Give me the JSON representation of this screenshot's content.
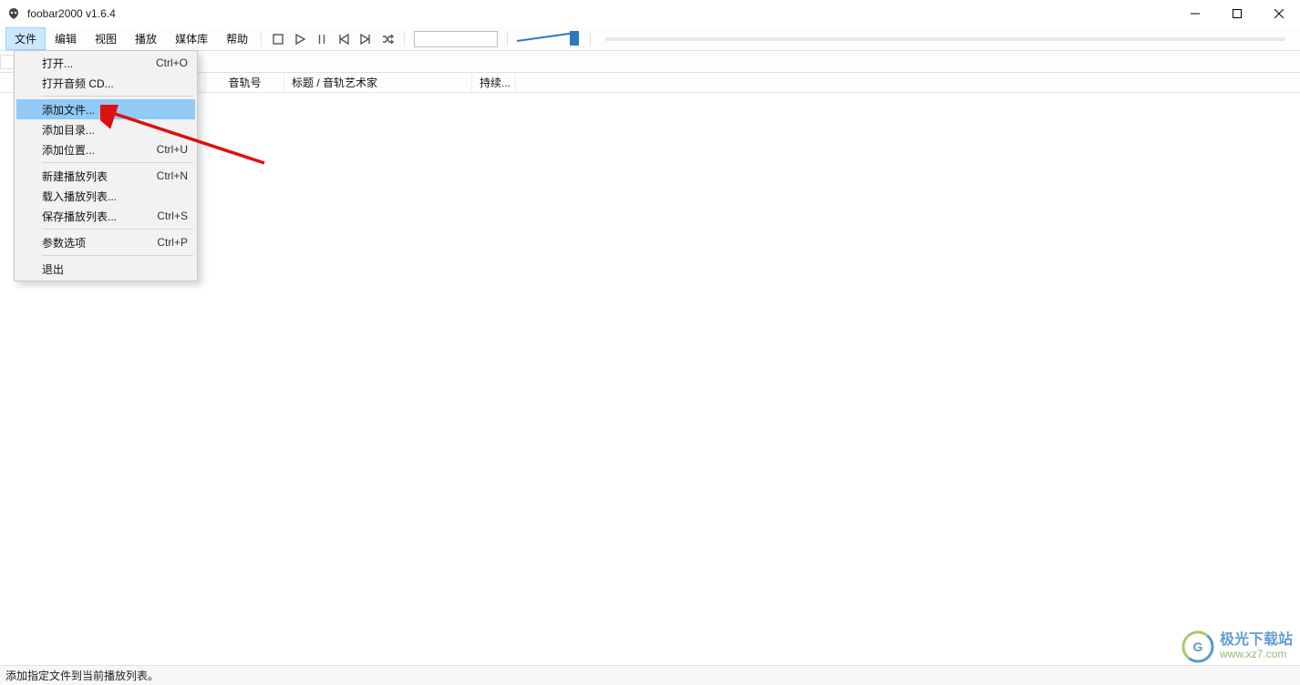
{
  "window": {
    "title": "foobar2000 v1.6.4"
  },
  "menubar": {
    "items": [
      "文件",
      "编辑",
      "视图",
      "播放",
      "媒体库",
      "帮助"
    ],
    "active_index": 0
  },
  "toolbar": {
    "icons": [
      "stop",
      "play",
      "pause",
      "prev",
      "next",
      "random"
    ],
    "search_placeholder": "",
    "volume_percent": 80
  },
  "columns": {
    "playing": "",
    "track": "音轨号",
    "title": "标题 / 音轨艺术家",
    "duration": "持续..."
  },
  "file_menu": {
    "items": [
      {
        "label": "打开...",
        "shortcut": "Ctrl+O",
        "highlight": false
      },
      {
        "label": "打开音频 CD...",
        "shortcut": "",
        "highlight": false
      },
      {
        "sep": true
      },
      {
        "label": "添加文件...",
        "shortcut": "",
        "highlight": true
      },
      {
        "label": "添加目录...",
        "shortcut": "",
        "highlight": false
      },
      {
        "label": "添加位置...",
        "shortcut": "Ctrl+U",
        "highlight": false
      },
      {
        "sep": true
      },
      {
        "label": "新建播放列表",
        "shortcut": "Ctrl+N",
        "highlight": false
      },
      {
        "label": "载入播放列表...",
        "shortcut": "",
        "highlight": false
      },
      {
        "label": "保存播放列表...",
        "shortcut": "Ctrl+S",
        "highlight": false
      },
      {
        "sep": true
      },
      {
        "label": "参数选项",
        "shortcut": "Ctrl+P",
        "highlight": false
      },
      {
        "sep": true
      },
      {
        "label": "退出",
        "shortcut": "",
        "highlight": false
      }
    ]
  },
  "statusbar": {
    "text": "添加指定文件到当前播放列表。"
  },
  "watermark": {
    "line1": "极光下载站",
    "line2": "www.xz7.com"
  }
}
